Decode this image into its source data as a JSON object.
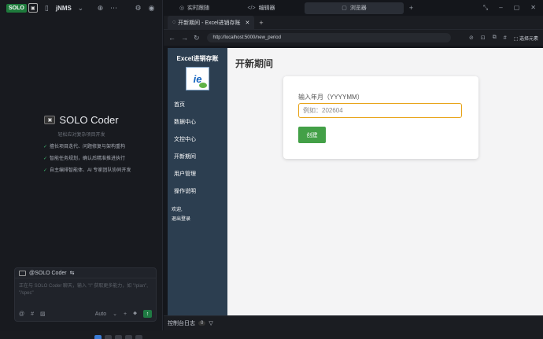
{
  "left_panel": {
    "badge_solo": "SOLO",
    "badge_icon": "▣",
    "project_title": "jNMS",
    "chevron": "⌄",
    "center_title": "SOLO Coder",
    "center_subtitle": "轻松应对复杂项目开发",
    "features": [
      "擅长项目迭代、问题修复与架构重构",
      "智能任务规划，确认后精准推进执行",
      "自主编排智能体、AI 专家团队协同开发"
    ],
    "chat_header": "@SOLO Coder",
    "chat_placeholder": "正在与 SOLO Coder 聊天，输入 \"/\" 获取更多能力，如 \"/plan\", \"/spec\"",
    "mode_label": "Auto"
  },
  "right_tabs": [
    {
      "label": "实时跟随",
      "icon": "follow-icon",
      "glyph": "◎"
    },
    {
      "label": "编辑器",
      "icon": "code-icon",
      "glyph": "</>"
    },
    {
      "label": "浏览器",
      "icon": "browser-icon",
      "glyph": "▢"
    }
  ],
  "browser": {
    "tab_title": "开新期间 - Excel进销存账",
    "url": "http://localhost:5000/new_period",
    "select_element": "选择元素",
    "console_label": "控制台日志",
    "console_count": "0"
  },
  "webpage": {
    "brand": "Excel进销存账",
    "logo_text": "ie",
    "menu": [
      "首页",
      "数据中心",
      "文控中心",
      "开新期间",
      "用户管理",
      "操作说明"
    ],
    "welcome": "欢迎,",
    "logout": "退出登录",
    "page_title": "开新期间",
    "field_label": "输入年月（YYYYMM）",
    "field_placeholder": "例如：202604",
    "submit_label": "创建",
    "colors": {
      "sidebar": "#2c3e50",
      "button": "#43a047",
      "input_border": "#e8a317"
    }
  }
}
